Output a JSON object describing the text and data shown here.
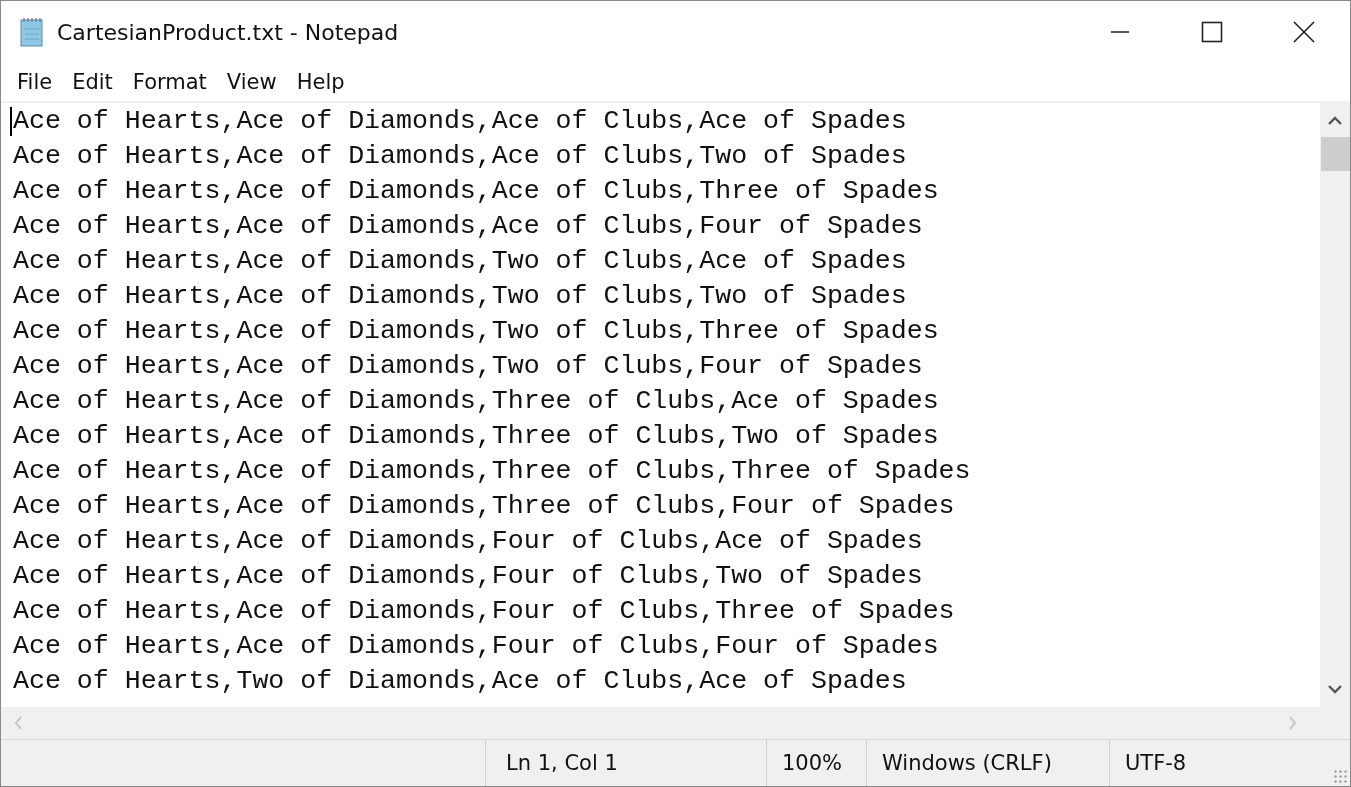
{
  "window": {
    "title": "CartesianProduct.txt - Notepad"
  },
  "menu": [
    {
      "label": "File"
    },
    {
      "label": "Edit"
    },
    {
      "label": "Format"
    },
    {
      "label": "View"
    },
    {
      "label": "Help"
    }
  ],
  "editor": {
    "lines": [
      "Ace of Hearts,Ace of Diamonds,Ace of Clubs,Ace of Spades",
      "Ace of Hearts,Ace of Diamonds,Ace of Clubs,Two of Spades",
      "Ace of Hearts,Ace of Diamonds,Ace of Clubs,Three of Spades",
      "Ace of Hearts,Ace of Diamonds,Ace of Clubs,Four of Spades",
      "Ace of Hearts,Ace of Diamonds,Two of Clubs,Ace of Spades",
      "Ace of Hearts,Ace of Diamonds,Two of Clubs,Two of Spades",
      "Ace of Hearts,Ace of Diamonds,Two of Clubs,Three of Spades",
      "Ace of Hearts,Ace of Diamonds,Two of Clubs,Four of Spades",
      "Ace of Hearts,Ace of Diamonds,Three of Clubs,Ace of Spades",
      "Ace of Hearts,Ace of Diamonds,Three of Clubs,Two of Spades",
      "Ace of Hearts,Ace of Diamonds,Three of Clubs,Three of Spades",
      "Ace of Hearts,Ace of Diamonds,Three of Clubs,Four of Spades",
      "Ace of Hearts,Ace of Diamonds,Four of Clubs,Ace of Spades",
      "Ace of Hearts,Ace of Diamonds,Four of Clubs,Two of Spades",
      "Ace of Hearts,Ace of Diamonds,Four of Clubs,Three of Spades",
      "Ace of Hearts,Ace of Diamonds,Four of Clubs,Four of Spades",
      "Ace of Hearts,Two of Diamonds,Ace of Clubs,Ace of Spades"
    ]
  },
  "status_bar": [
    "Ln 1, Col 1",
    "100%",
    "Windows (CRLF)",
    "UTF-8"
  ]
}
